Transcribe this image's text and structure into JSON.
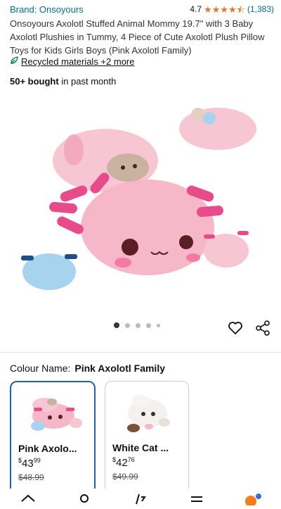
{
  "brand": {
    "label": "Brand: Onsoyours"
  },
  "rating": {
    "value": "4.7",
    "count": "(1,383)",
    "stars_icon": "star-rating-icon",
    "color": "#DE7921"
  },
  "product": {
    "title": "Onsoyours Axolotl Stuffed Animal Mommy 19.7\" with 3 Baby Axolotl Plushies in Tummy, 4 Piece of Cute Axolotl Plush Pillow Toys for Kids Girls Boys (Pink Axolotl Family)"
  },
  "recycled": {
    "icon": "leaf-icon",
    "label": "Recycled materials +2 more"
  },
  "bought": {
    "bold": "50+ bought",
    "rest": " in past month"
  },
  "gallery": {
    "dots": 5,
    "active_index": 0
  },
  "colour": {
    "label": "Colour Name:",
    "value": "Pink Axolotl Family",
    "options": [
      {
        "name": "Pink Axolo...",
        "currency": "$",
        "price_whole": "43",
        "price_frac": "99",
        "old_price": "$48.99",
        "selected": true
      },
      {
        "name": "White Cat ...",
        "currency": "$",
        "price_whole": "42",
        "price_frac": "76",
        "old_price": "$49.99",
        "selected": false
      }
    ]
  },
  "colors": {
    "link": "#007185",
    "selected_border": "#2162A1",
    "pink": "#F6B7C8",
    "pink_accent": "#E84B8A"
  },
  "nav": {
    "icons": [
      "home-icon",
      "account-icon",
      "compare-icon",
      "menu-icon",
      "assistant-icon"
    ]
  }
}
